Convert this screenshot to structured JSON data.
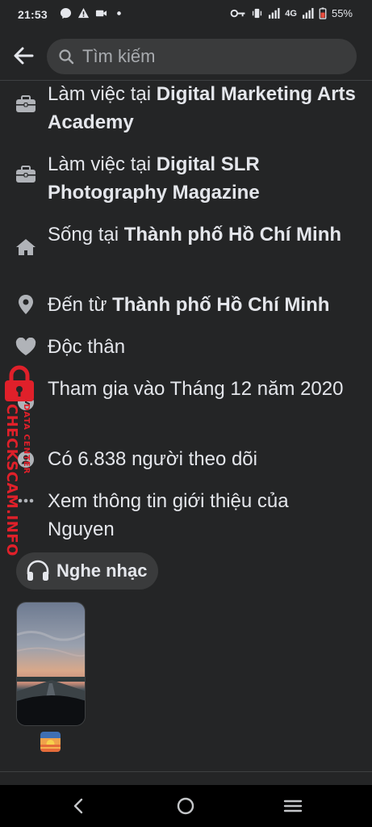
{
  "status_bar": {
    "time": "21:53",
    "network": "4G",
    "battery": "55%"
  },
  "header": {
    "search_placeholder": "Tìm kiếm"
  },
  "intro": {
    "items": [
      {
        "icon": "briefcase-icon",
        "prefix": "Làm việc tại ",
        "bold": "Digital Marketing Arts Academy"
      },
      {
        "icon": "briefcase-icon",
        "prefix": "Làm việc tại ",
        "bold": "Digital SLR Photography Magazine"
      },
      {
        "icon": "home-icon",
        "prefix": "Sống tại ",
        "bold": "Thành phố Hồ Chí Minh"
      },
      {
        "icon": "location-pin-icon",
        "prefix": "Đến từ ",
        "bold": "Thành phố Hồ Chí Minh"
      },
      {
        "icon": "heart-icon",
        "prefix": "Độc thân",
        "bold": ""
      },
      {
        "icon": "clock-icon",
        "prefix": "Tham gia vào Tháng 12 năm 2020",
        "bold": ""
      },
      {
        "icon": "followers-icon",
        "prefix": "Có 6.838 người theo dõi",
        "bold": ""
      },
      {
        "icon": "more-dots-icon",
        "prefix": "Xem thông tin giới thiệu của Nguyen",
        "bold": ""
      }
    ]
  },
  "music": {
    "label": "Nghe nhạc",
    "icon": "headphones-icon"
  },
  "watermark": {
    "main": "CHECKSCAM.INFO",
    "small": "DATA CENTER"
  },
  "colors": {
    "background": "#242526",
    "chip": "#3a3b3c",
    "text": "#e4e6eb",
    "icon": "#b0b3b8",
    "watermark": "#e0202a"
  }
}
